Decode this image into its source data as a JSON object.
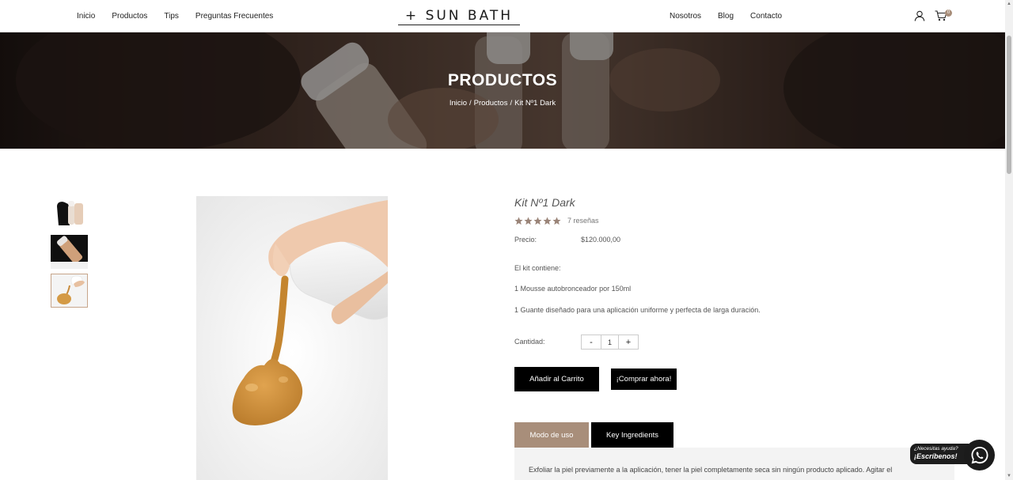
{
  "header": {
    "nav_left": [
      "Inicio",
      "Productos",
      "Tips",
      "Preguntas Frecuentes"
    ],
    "logo": "+ SUN BATH",
    "nav_right": [
      "Nosotros",
      "Blog",
      "Contacto"
    ],
    "cart_count": "0"
  },
  "hero": {
    "title": "PRODUCTOS",
    "breadcrumb": [
      "Inicio",
      "Productos",
      "Kit Nº1 Dark"
    ],
    "separator": "/"
  },
  "product": {
    "title": "Kit Nº1 Dark",
    "rating": 5,
    "reviews": "7 reseñas",
    "price_label": "Precio:",
    "price": "$120.000,00",
    "description": [
      "El kit contiene:",
      "1 Mousse autobronceador por 150ml",
      "1 Guante diseñado para una aplicación uniforme y perfecta de larga duración."
    ],
    "quantity_label": "Cantidad:",
    "quantity": "1",
    "minus": "-",
    "plus": "+",
    "add_to_cart": "Añadir al Carrito",
    "buy_now": "¡Comprar ahora!",
    "tabs": [
      "Modo de uso",
      "Key Ingredients"
    ],
    "tab_content": "Exfoliar la piel previamente a la aplicación, tener la piel completamente seca sin ningún producto aplicado.  Agitar el"
  },
  "help": {
    "small": "¿Necesitas ayuda?",
    "big": "¡Escríbenos!"
  },
  "colors": {
    "accent": "#a88e7a",
    "button": "#000000"
  }
}
